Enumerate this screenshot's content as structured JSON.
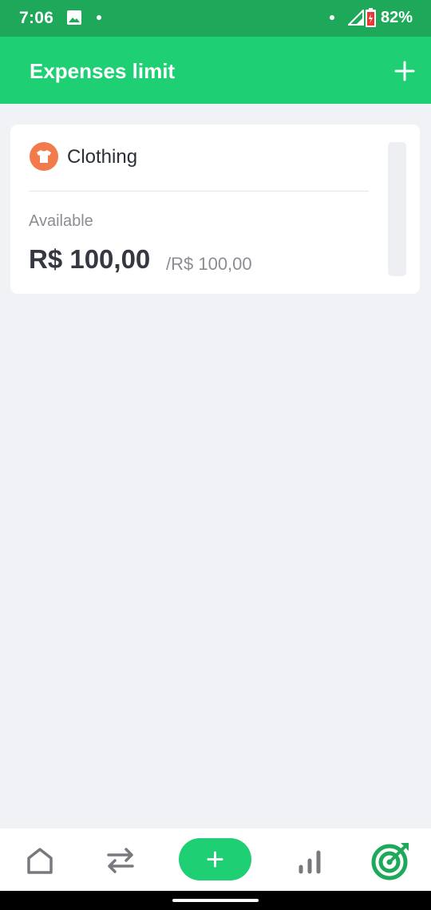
{
  "status_bar": {
    "time": "7:06",
    "battery": "82%",
    "icons": [
      "image-icon",
      "notification-dot",
      "signal-icon",
      "battery-icon"
    ]
  },
  "app_bar": {
    "title": "Expenses limit",
    "add_icon": "plus-icon"
  },
  "limits": [
    {
      "category": "Clothing",
      "category_icon": "shirt-icon",
      "category_color": "#f27b4d",
      "available_label": "Available",
      "available_amount": "R$ 100,00",
      "limit_amount": "/R$ 100,00",
      "spent_fraction": 0
    }
  ],
  "bottom_nav": {
    "items": [
      "home-icon",
      "transfer-icon",
      "plus-icon",
      "bar-chart-icon",
      "target-icon"
    ],
    "active": "target-icon"
  },
  "colors": {
    "status_bar": "#1ea85a",
    "accent": "#1fcf73",
    "active_nav": "#1ea85a",
    "background": "#f1f2f5"
  }
}
